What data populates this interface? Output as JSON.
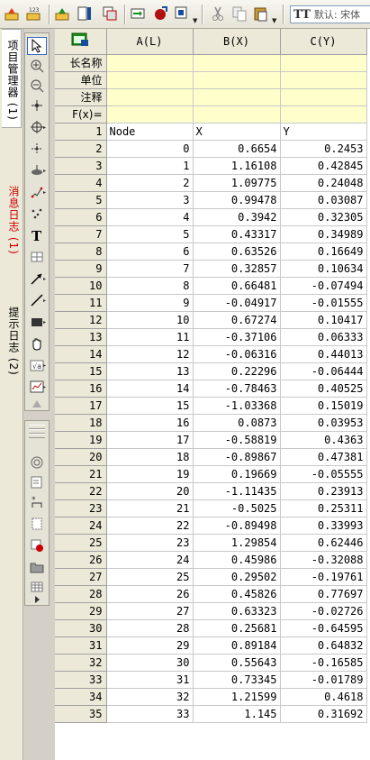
{
  "toolbar": {
    "font_name": "默认: 宋体",
    "font_icon": "TT"
  },
  "side_tabs": [
    {
      "label": "项目管理器 (1)",
      "color": "#000000"
    },
    {
      "label": "消息日志 (1)",
      "color": "#cc0000"
    },
    {
      "label": "提示日志 (2)",
      "color": "#000000"
    }
  ],
  "sheet": {
    "columns": [
      "A(L)",
      "B(X)",
      "C(Y)"
    ],
    "meta_rows": [
      "长名称",
      "单位",
      "注释",
      "F(x)="
    ],
    "rows": [
      {
        "n": "1",
        "a": "Node",
        "b": "X",
        "c": "Y"
      },
      {
        "n": "2",
        "a": "0",
        "b": "0.6654",
        "c": "0.2453"
      },
      {
        "n": "3",
        "a": "1",
        "b": "1.16108",
        "c": "0.42845"
      },
      {
        "n": "4",
        "a": "2",
        "b": "1.09775",
        "c": "0.24048"
      },
      {
        "n": "5",
        "a": "3",
        "b": "0.99478",
        "c": "0.03087"
      },
      {
        "n": "6",
        "a": "4",
        "b": "0.3942",
        "c": "0.32305"
      },
      {
        "n": "7",
        "a": "5",
        "b": "0.43317",
        "c": "0.34989"
      },
      {
        "n": "8",
        "a": "6",
        "b": "0.63526",
        "c": "0.16649"
      },
      {
        "n": "9",
        "a": "7",
        "b": "0.32857",
        "c": "0.10634"
      },
      {
        "n": "10",
        "a": "8",
        "b": "0.66481",
        "c": "-0.07494"
      },
      {
        "n": "11",
        "a": "9",
        "b": "-0.04917",
        "c": "-0.01555"
      },
      {
        "n": "12",
        "a": "10",
        "b": "0.67274",
        "c": "0.10417"
      },
      {
        "n": "13",
        "a": "11",
        "b": "-0.37106",
        "c": "0.06333"
      },
      {
        "n": "14",
        "a": "12",
        "b": "-0.06316",
        "c": "0.44013"
      },
      {
        "n": "15",
        "a": "13",
        "b": "0.22296",
        "c": "-0.06444"
      },
      {
        "n": "16",
        "a": "14",
        "b": "-0.78463",
        "c": "0.40525"
      },
      {
        "n": "17",
        "a": "15",
        "b": "-1.03368",
        "c": "0.15019"
      },
      {
        "n": "18",
        "a": "16",
        "b": "0.0873",
        "c": "0.03953"
      },
      {
        "n": "19",
        "a": "17",
        "b": "-0.58819",
        "c": "0.4363"
      },
      {
        "n": "20",
        "a": "18",
        "b": "-0.89867",
        "c": "0.47381"
      },
      {
        "n": "21",
        "a": "19",
        "b": "0.19669",
        "c": "-0.05555"
      },
      {
        "n": "22",
        "a": "20",
        "b": "-1.11435",
        "c": "0.23913"
      },
      {
        "n": "23",
        "a": "21",
        "b": "-0.5025",
        "c": "0.25311"
      },
      {
        "n": "24",
        "a": "22",
        "b": "-0.89498",
        "c": "0.33993"
      },
      {
        "n": "25",
        "a": "23",
        "b": "1.29854",
        "c": "0.62446"
      },
      {
        "n": "26",
        "a": "24",
        "b": "0.45986",
        "c": "-0.32088"
      },
      {
        "n": "27",
        "a": "25",
        "b": "0.29502",
        "c": "-0.19761"
      },
      {
        "n": "28",
        "a": "26",
        "b": "0.45826",
        "c": "0.77697"
      },
      {
        "n": "29",
        "a": "27",
        "b": "0.63323",
        "c": "-0.02726"
      },
      {
        "n": "30",
        "a": "28",
        "b": "0.25681",
        "c": "-0.64595"
      },
      {
        "n": "31",
        "a": "29",
        "b": "0.89184",
        "c": "0.64832"
      },
      {
        "n": "32",
        "a": "30",
        "b": "0.55643",
        "c": "-0.16585"
      },
      {
        "n": "33",
        "a": "31",
        "b": "0.73345",
        "c": "-0.01789"
      },
      {
        "n": "34",
        "a": "32",
        "b": "1.21599",
        "c": "0.4618"
      },
      {
        "n": "35",
        "a": "33",
        "b": "1.145",
        "c": "0.31692"
      }
    ]
  }
}
